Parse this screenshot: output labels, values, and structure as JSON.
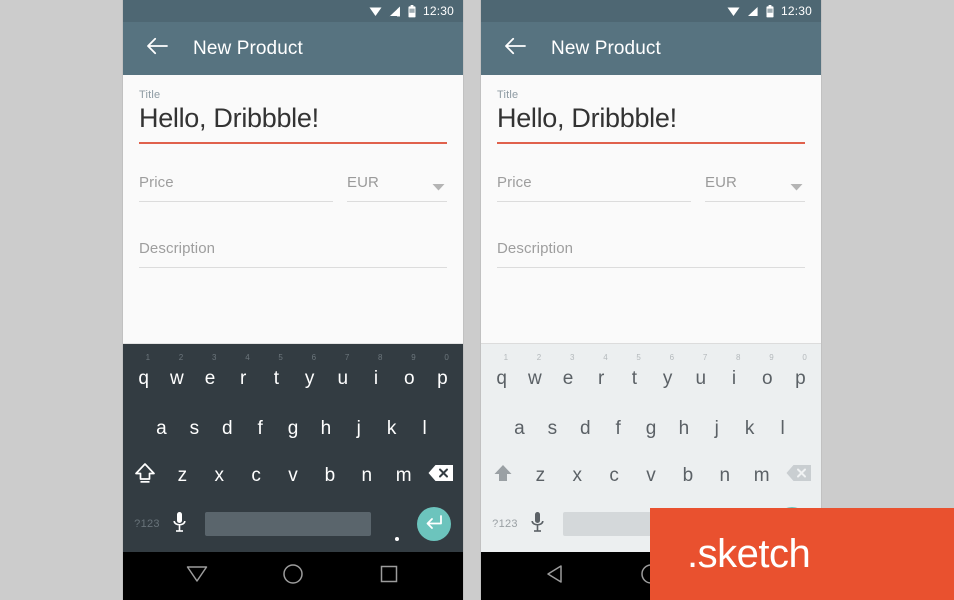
{
  "page": {
    "background_color": "#cccccc",
    "badge": {
      "label": ".sketch",
      "background_color": "#e9512f",
      "text_color": "#ffffff"
    }
  },
  "colors": {
    "statusbar": "#4e6773",
    "appbar": "#577380",
    "accent_underline": "#e0614c",
    "enter_key": "#6cc4bd",
    "keyboard_dark": "#333c42",
    "keyboard_light": "#eceff0",
    "navbar": "#000000"
  },
  "statusbar": {
    "time": "12:30",
    "icons": [
      "wifi-icon",
      "signal-icon",
      "battery-icon"
    ]
  },
  "appbar": {
    "back_icon": "arrow-left-icon",
    "title": "New Product"
  },
  "form": {
    "title_field": {
      "label": "Title",
      "value": "Hello, Dribbble!",
      "state": "focused"
    },
    "price_field": {
      "placeholder": "Price",
      "value": ""
    },
    "currency_field": {
      "value": "EUR",
      "caret_icon": "chevron-down-icon",
      "options": [
        "EUR"
      ]
    },
    "description_field": {
      "placeholder": "Description",
      "value": ""
    }
  },
  "keyboard": {
    "row1": [
      {
        "letter": "q",
        "num": "1"
      },
      {
        "letter": "w",
        "num": "2"
      },
      {
        "letter": "e",
        "num": "3"
      },
      {
        "letter": "r",
        "num": "4"
      },
      {
        "letter": "t",
        "num": "5"
      },
      {
        "letter": "y",
        "num": "6"
      },
      {
        "letter": "u",
        "num": "7"
      },
      {
        "letter": "i",
        "num": "8"
      },
      {
        "letter": "o",
        "num": "9"
      },
      {
        "letter": "p",
        "num": "0"
      }
    ],
    "row2": [
      {
        "letter": "a"
      },
      {
        "letter": "s"
      },
      {
        "letter": "d"
      },
      {
        "letter": "f"
      },
      {
        "letter": "g"
      },
      {
        "letter": "h"
      },
      {
        "letter": "j"
      },
      {
        "letter": "k"
      },
      {
        "letter": "l"
      }
    ],
    "row3": [
      {
        "letter": "z"
      },
      {
        "letter": "x"
      },
      {
        "letter": "c"
      },
      {
        "letter": "v"
      },
      {
        "letter": "b"
      },
      {
        "letter": "n"
      },
      {
        "letter": "m"
      }
    ],
    "shift_icon": "shift-arrow-icon",
    "backspace_icon": "backspace-icon",
    "symbols_label": "?123",
    "mic_icon": "microphone-icon",
    "space_label": "",
    "period_label": ".",
    "enter_icon": "enter-return-icon"
  },
  "navbar_left": {
    "back_icon": "triangle-down-back-icon",
    "home_icon": "circle-home-icon",
    "recents_icon": "square-recents-icon"
  },
  "navbar_right": {
    "back_icon": "triangle-left-back-icon",
    "home_icon": "circle-home-icon",
    "recents_icon": "square-recents-icon"
  },
  "phones": [
    {
      "name": "phone-dark-keyboard",
      "keyboard_theme": "dark"
    },
    {
      "name": "phone-light-keyboard",
      "keyboard_theme": "light"
    }
  ]
}
